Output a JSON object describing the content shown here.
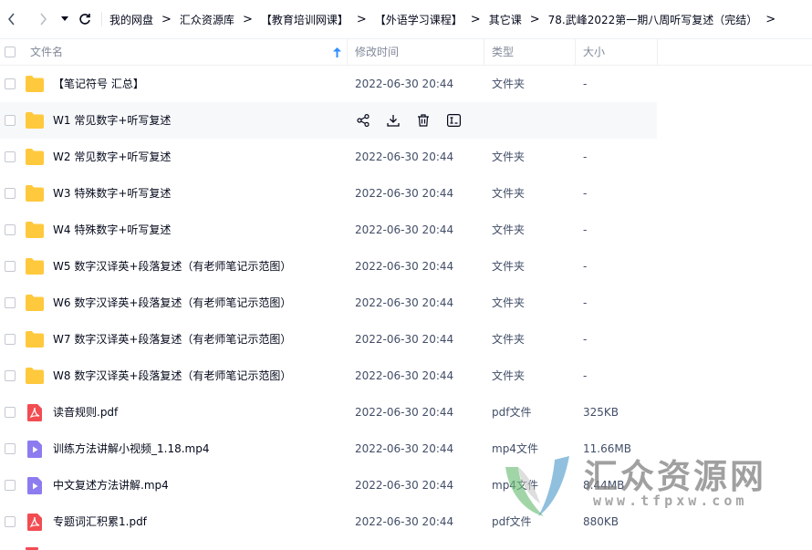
{
  "nav": {
    "back_icon": "chevron-left-icon",
    "forward_icon": "chevron-right-icon",
    "dropdown_icon": "caret-down-icon",
    "refresh_icon": "refresh-icon",
    "breadcrumbs": [
      "我的网盘",
      "汇众资源库",
      "【教育培训网课】",
      "【外语学习课程】",
      "其它课",
      "78.武峰2022第一期八周听写复述（完结）"
    ],
    "separator": ">"
  },
  "table": {
    "headers": {
      "name": "文件名",
      "modified": "修改时间",
      "type": "类型",
      "size": "大小"
    },
    "sort_icon": "sort-arrow-up-icon",
    "sort_color": "#2f8fff",
    "hover_actions": [
      "share-icon",
      "download-icon",
      "delete-icon",
      "rename-icon"
    ],
    "rows": [
      {
        "icon": "folder",
        "name": "【笔记符号 汇总】",
        "date": "2022-06-30 20:44",
        "type": "文件夹",
        "size": "-"
      },
      {
        "icon": "folder",
        "name": "W1 常见数字+听写复述",
        "date": "",
        "type": "",
        "size": "",
        "hovered": true
      },
      {
        "icon": "folder",
        "name": "W2 常见数字+听写复述",
        "date": "2022-06-30 20:44",
        "type": "文件夹",
        "size": "-"
      },
      {
        "icon": "folder",
        "name": "W3 特殊数字+听写复述",
        "date": "2022-06-30 20:44",
        "type": "文件夹",
        "size": "-"
      },
      {
        "icon": "folder",
        "name": "W4 特殊数字+听写复述",
        "date": "2022-06-30 20:44",
        "type": "文件夹",
        "size": "-"
      },
      {
        "icon": "folder",
        "name": "W5 数字汉译英+段落复述（有老师笔记示范图）",
        "date": "2022-06-30 20:44",
        "type": "文件夹",
        "size": "-"
      },
      {
        "icon": "folder",
        "name": "W6 数字汉译英+段落复述（有老师笔记示范图）",
        "date": "2022-06-30 20:44",
        "type": "文件夹",
        "size": "-"
      },
      {
        "icon": "folder",
        "name": "W7 数字汉译英+段落复述（有老师笔记示范图）",
        "date": "2022-06-30 20:44",
        "type": "文件夹",
        "size": "-"
      },
      {
        "icon": "folder",
        "name": "W8 数字汉译英+段落复述（有老师笔记示范图）",
        "date": "2022-06-30 20:44",
        "type": "文件夹",
        "size": "-"
      },
      {
        "icon": "pdf",
        "name": "读音规则.pdf",
        "date": "2022-06-30 20:44",
        "type": "pdf文件",
        "size": "325KB"
      },
      {
        "icon": "video",
        "name": "训练方法讲解小视频_1.18.mp4",
        "date": "2022-06-30 20:44",
        "type": "mp4文件",
        "size": "11.66MB"
      },
      {
        "icon": "video",
        "name": "中文复述方法讲解.mp4",
        "date": "2022-06-30 20:44",
        "type": "mp4文件",
        "size": "8.44MB"
      },
      {
        "icon": "pdf",
        "name": "专题词汇积累1.pdf",
        "date": "2022-06-30 20:44",
        "type": "pdf文件",
        "size": "880KB"
      }
    ]
  },
  "colors": {
    "folder": "#ffc93d",
    "pdf": "#f24c52",
    "video": "#8c7cf0",
    "text_primary": "#03081a",
    "text_secondary": "#424e67"
  },
  "watermark": {
    "title": "汇众资源网",
    "url": "www.tfpxw.com"
  }
}
